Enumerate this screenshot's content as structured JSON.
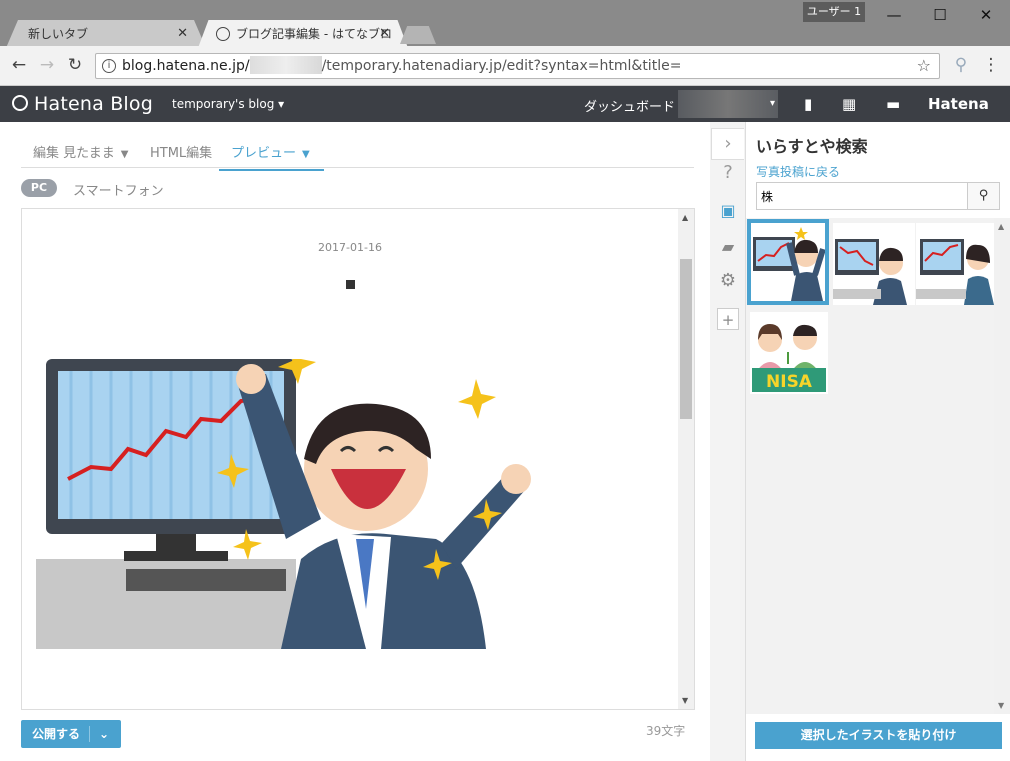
{
  "window": {
    "user_label": "ユーザー 1",
    "minimize": "—",
    "maximize": "☐",
    "close": "✕"
  },
  "tabs": [
    {
      "label": "新しいタブ"
    },
    {
      "label": "ブログ記事編集 - はてなブロ"
    }
  ],
  "toolbar": {
    "url_host": "blog.hatena.ne.jp/",
    "url_rest": "/temporary.hatenadiary.jp/edit?syntax=html&title="
  },
  "header": {
    "logo": "Hatena Blog",
    "blog_name": "temporary's blog ▾",
    "dashboard": "ダッシュボード",
    "brand": "Hatena"
  },
  "editor": {
    "mode_tabs": [
      {
        "label": "編集 見たまま"
      },
      {
        "label": "HTML編集"
      },
      {
        "label": "プレビュー"
      }
    ],
    "pc_label": "PC",
    "smartphone_label": "スマートフォン",
    "preview_date": "2017-01-16",
    "publish_label": "公開する",
    "char_count": "39文字"
  },
  "panel": {
    "title": "いらすとや検索",
    "back_link": "写真投稿に戻る",
    "search_value": "株",
    "paste_button": "選択したイラストを貼り付け",
    "nisa_label": "NISA"
  },
  "colors": {
    "accent": "#4aa2cf",
    "header_bg": "#3c3f45"
  }
}
